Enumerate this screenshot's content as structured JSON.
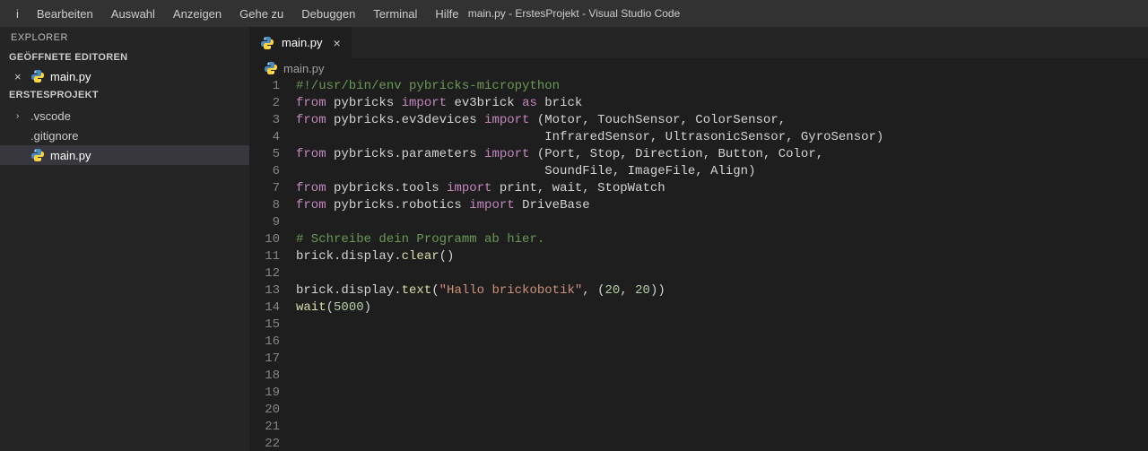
{
  "menubar": [
    "i",
    "Bearbeiten",
    "Auswahl",
    "Anzeigen",
    "Gehe zu",
    "Debuggen",
    "Terminal",
    "Hilfe"
  ],
  "window_title": "main.py - ErstesProjekt - Visual Studio Code",
  "sidebar": {
    "panel": "EXPLORER",
    "open_editors_label": "GEÖFFNETE EDITOREN",
    "open_editors": [
      {
        "name": "main.py"
      }
    ],
    "project_label": "ERSTESPROJEKT",
    "tree": [
      {
        "kind": "folder",
        "name": ".vscode"
      },
      {
        "kind": "file",
        "name": ".gitignore"
      },
      {
        "kind": "file",
        "name": "main.py",
        "selected": true,
        "icon": "python"
      }
    ]
  },
  "tabs": [
    {
      "name": "main.py"
    }
  ],
  "breadcrumb": {
    "file": "main.py"
  },
  "code": {
    "total_lines": 22,
    "lines": [
      {
        "n": 1,
        "t": [
          [
            "com",
            "#!/usr/bin/env pybricks-micropython"
          ]
        ]
      },
      {
        "n": 2,
        "t": [
          [
            "kw",
            "from"
          ],
          [
            "",
            " pybricks "
          ],
          [
            "kw",
            "import"
          ],
          [
            "",
            " ev3brick "
          ],
          [
            "kw",
            "as"
          ],
          [
            "",
            " brick"
          ]
        ]
      },
      {
        "n": 3,
        "t": [
          [
            "kw",
            "from"
          ],
          [
            "",
            " pybricks.ev3devices "
          ],
          [
            "kw",
            "import"
          ],
          [
            "",
            " (Motor, TouchSensor, ColorSensor,"
          ]
        ]
      },
      {
        "n": 4,
        "t": [
          [
            "",
            "                                 InfraredSensor, UltrasonicSensor, GyroSensor)"
          ]
        ]
      },
      {
        "n": 5,
        "t": [
          [
            "kw",
            "from"
          ],
          [
            "",
            " pybricks.parameters "
          ],
          [
            "kw",
            "import"
          ],
          [
            "",
            " (Port, Stop, Direction, Button, Color,"
          ]
        ]
      },
      {
        "n": 6,
        "t": [
          [
            "",
            "                                 SoundFile, ImageFile, Align)"
          ]
        ]
      },
      {
        "n": 7,
        "t": [
          [
            "kw",
            "from"
          ],
          [
            "",
            " pybricks.tools "
          ],
          [
            "kw",
            "import"
          ],
          [
            "",
            " print, wait, StopWatch"
          ]
        ]
      },
      {
        "n": 8,
        "t": [
          [
            "kw",
            "from"
          ],
          [
            "",
            " pybricks.robotics "
          ],
          [
            "kw",
            "import"
          ],
          [
            "",
            " DriveBase"
          ]
        ]
      },
      {
        "n": 9,
        "t": []
      },
      {
        "n": 10,
        "t": [
          [
            "com",
            "# Schreibe dein Programm ab hier."
          ]
        ]
      },
      {
        "n": 11,
        "t": [
          [
            "",
            "brick.display."
          ],
          [
            "fn",
            "clear"
          ],
          [
            "",
            "()"
          ]
        ]
      },
      {
        "n": 12,
        "t": []
      },
      {
        "n": 13,
        "t": [
          [
            "",
            "brick.display."
          ],
          [
            "fn",
            "text"
          ],
          [
            "",
            "("
          ],
          [
            "str",
            "\"Hallo brickobotik\""
          ],
          [
            "",
            ", ("
          ],
          [
            "num",
            "20"
          ],
          [
            "",
            ", "
          ],
          [
            "num",
            "20"
          ],
          [
            "",
            "))"
          ]
        ]
      },
      {
        "n": 14,
        "t": [
          [
            "fn",
            "wait"
          ],
          [
            "",
            "("
          ],
          [
            "num",
            "5000"
          ],
          [
            "",
            ")"
          ]
        ]
      },
      {
        "n": 15,
        "t": []
      },
      {
        "n": 16,
        "t": []
      },
      {
        "n": 17,
        "t": []
      },
      {
        "n": 18,
        "t": []
      },
      {
        "n": 19,
        "t": []
      },
      {
        "n": 20,
        "t": []
      },
      {
        "n": 21,
        "t": []
      },
      {
        "n": 22,
        "t": []
      }
    ]
  }
}
